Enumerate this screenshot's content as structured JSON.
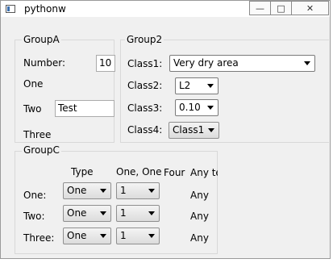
{
  "window": {
    "title": "pythonw",
    "minimize_glyph": "—",
    "maximize_glyph": "□",
    "close_glyph": "✕"
  },
  "groupA": {
    "title": "GroupA",
    "number_label": "Number:",
    "number_value": "10",
    "one_label": "One",
    "two_label": "Two",
    "two_value": "Test",
    "three_label": "Three"
  },
  "group2": {
    "title": "Group2",
    "class1_label": "Class1:",
    "class1_value": "Very dry area",
    "class2_label": "Class2:",
    "class2_value": "L2",
    "class3_label": "Class3:",
    "class3_value": "0.10",
    "class4_label": "Class4:",
    "class4_value": "Class1"
  },
  "groupC": {
    "title": "GroupC",
    "headers": [
      "Type",
      "One, One",
      "Four",
      "Any te"
    ],
    "rows": [
      {
        "label": "One:",
        "type": "One",
        "num": "1",
        "any": "Any"
      },
      {
        "label": "Two:",
        "type": "One",
        "num": "1",
        "any": "Any"
      },
      {
        "label": "Three:",
        "type": "One",
        "num": "1",
        "any": "Any"
      }
    ]
  }
}
